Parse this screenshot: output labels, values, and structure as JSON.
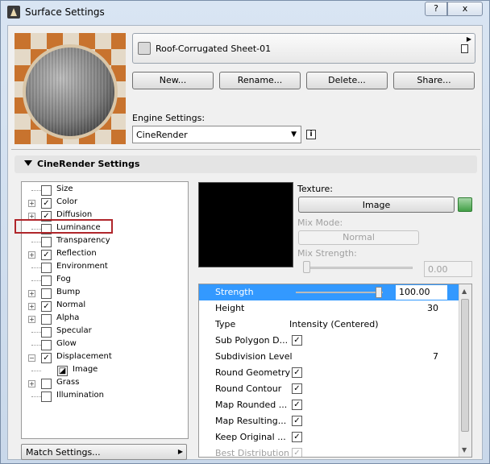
{
  "window": {
    "title": "Surface Settings",
    "help_label": "?",
    "close_label": "x"
  },
  "surface": {
    "name": "Roof-Corrugated Sheet-01"
  },
  "buttons": {
    "new": "New...",
    "rename": "Rename...",
    "delete": "Delete...",
    "share": "Share..."
  },
  "engine": {
    "label": "Engine Settings:",
    "value": "CineRender",
    "info": "i"
  },
  "section": {
    "title": "CineRender Settings"
  },
  "tree": {
    "items": [
      {
        "label": "Size",
        "checked": false,
        "expander": false
      },
      {
        "label": "Color",
        "checked": true,
        "expander": true
      },
      {
        "label": "Diffusion",
        "checked": true,
        "expander": true
      },
      {
        "label": "Luminance",
        "checked": false,
        "expander": false
      },
      {
        "label": "Transparency",
        "checked": false,
        "expander": false
      },
      {
        "label": "Reflection",
        "checked": true,
        "expander": true
      },
      {
        "label": "Environment",
        "checked": false,
        "expander": false
      },
      {
        "label": "Fog",
        "checked": false,
        "expander": false
      },
      {
        "label": "Bump",
        "checked": false,
        "expander": true
      },
      {
        "label": "Normal",
        "checked": true,
        "expander": true
      },
      {
        "label": "Alpha",
        "checked": false,
        "expander": true
      },
      {
        "label": "Specular",
        "checked": false,
        "expander": false
      },
      {
        "label": "Glow",
        "checked": false,
        "expander": false
      },
      {
        "label": "Displacement",
        "checked": true,
        "expander": true
      },
      {
        "label": "Image",
        "checked": false,
        "expander": false
      },
      {
        "label": "Grass",
        "checked": false,
        "expander": true
      },
      {
        "label": "Illumination",
        "checked": false,
        "expander": false
      }
    ]
  },
  "match_settings": {
    "label": "Match Settings..."
  },
  "texture": {
    "label": "Texture:",
    "button": "Image",
    "mix_mode_label": "Mix Mode:",
    "mix_mode_value": "Normal",
    "mix_strength_label": "Mix Strength:",
    "mix_strength_value": "0.00"
  },
  "params": {
    "strength": {
      "label": "Strength",
      "value": "100.00",
      "slider_fraction": 1.0
    },
    "height": {
      "label": "Height",
      "value": "30"
    },
    "type": {
      "label": "Type",
      "value": "Intensity (Centered)"
    },
    "sub_polygon": {
      "label": "Sub Polygon D...",
      "checked": true
    },
    "subdivision": {
      "label": "Subdivision Level",
      "value": "7"
    },
    "round_geometry": {
      "label": "Round Geometry",
      "checked": true
    },
    "round_contour": {
      "label": "Round Contour",
      "checked": true
    },
    "map_rounded": {
      "label": "Map Rounded ...",
      "checked": true
    },
    "map_resulting": {
      "label": "Map Resulting...",
      "checked": true
    },
    "keep_original": {
      "label": "Keep Original ...",
      "checked": true
    },
    "best_distribution": {
      "label": "Best Distribution",
      "checked": true
    }
  },
  "colors": {
    "selection": "#3399ff",
    "highlight_box": "#b0262b"
  }
}
